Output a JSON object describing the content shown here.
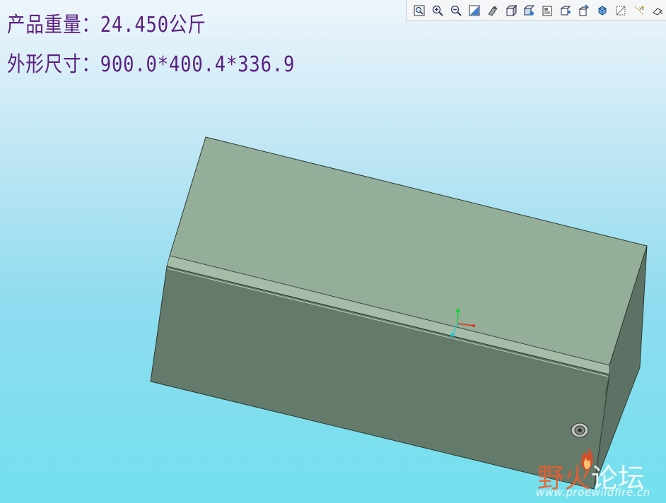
{
  "annotations": {
    "weight": "产品重量：24.450公斤",
    "dimensions": "外形尺寸：900.0*400.4*336.9"
  },
  "toolbar": {
    "buttons": [
      "refit-icon",
      "zoom-in-icon",
      "zoom-out-icon",
      "repaint-icon",
      "spin-center-icon",
      "display-style-icon",
      "saved-views-icon",
      "view-manager-icon",
      "layers-icon",
      "appearance-icon",
      "named-view-icon",
      "datum-planes-icon",
      "datum-axes-icon",
      "datum-points-icon"
    ]
  },
  "watermark": {
    "brand_highlight": "野火",
    "brand_rest": "论坛",
    "url": "www.proewildfire.cn"
  },
  "colors": {
    "annotation_text": "#5a1f80",
    "box_top": "#94ae99",
    "box_front": "#647a6b",
    "box_side": "#5d7264",
    "axis_x": "#e03020",
    "axis_y": "#20d040",
    "axis_z": "#20c8d0"
  }
}
